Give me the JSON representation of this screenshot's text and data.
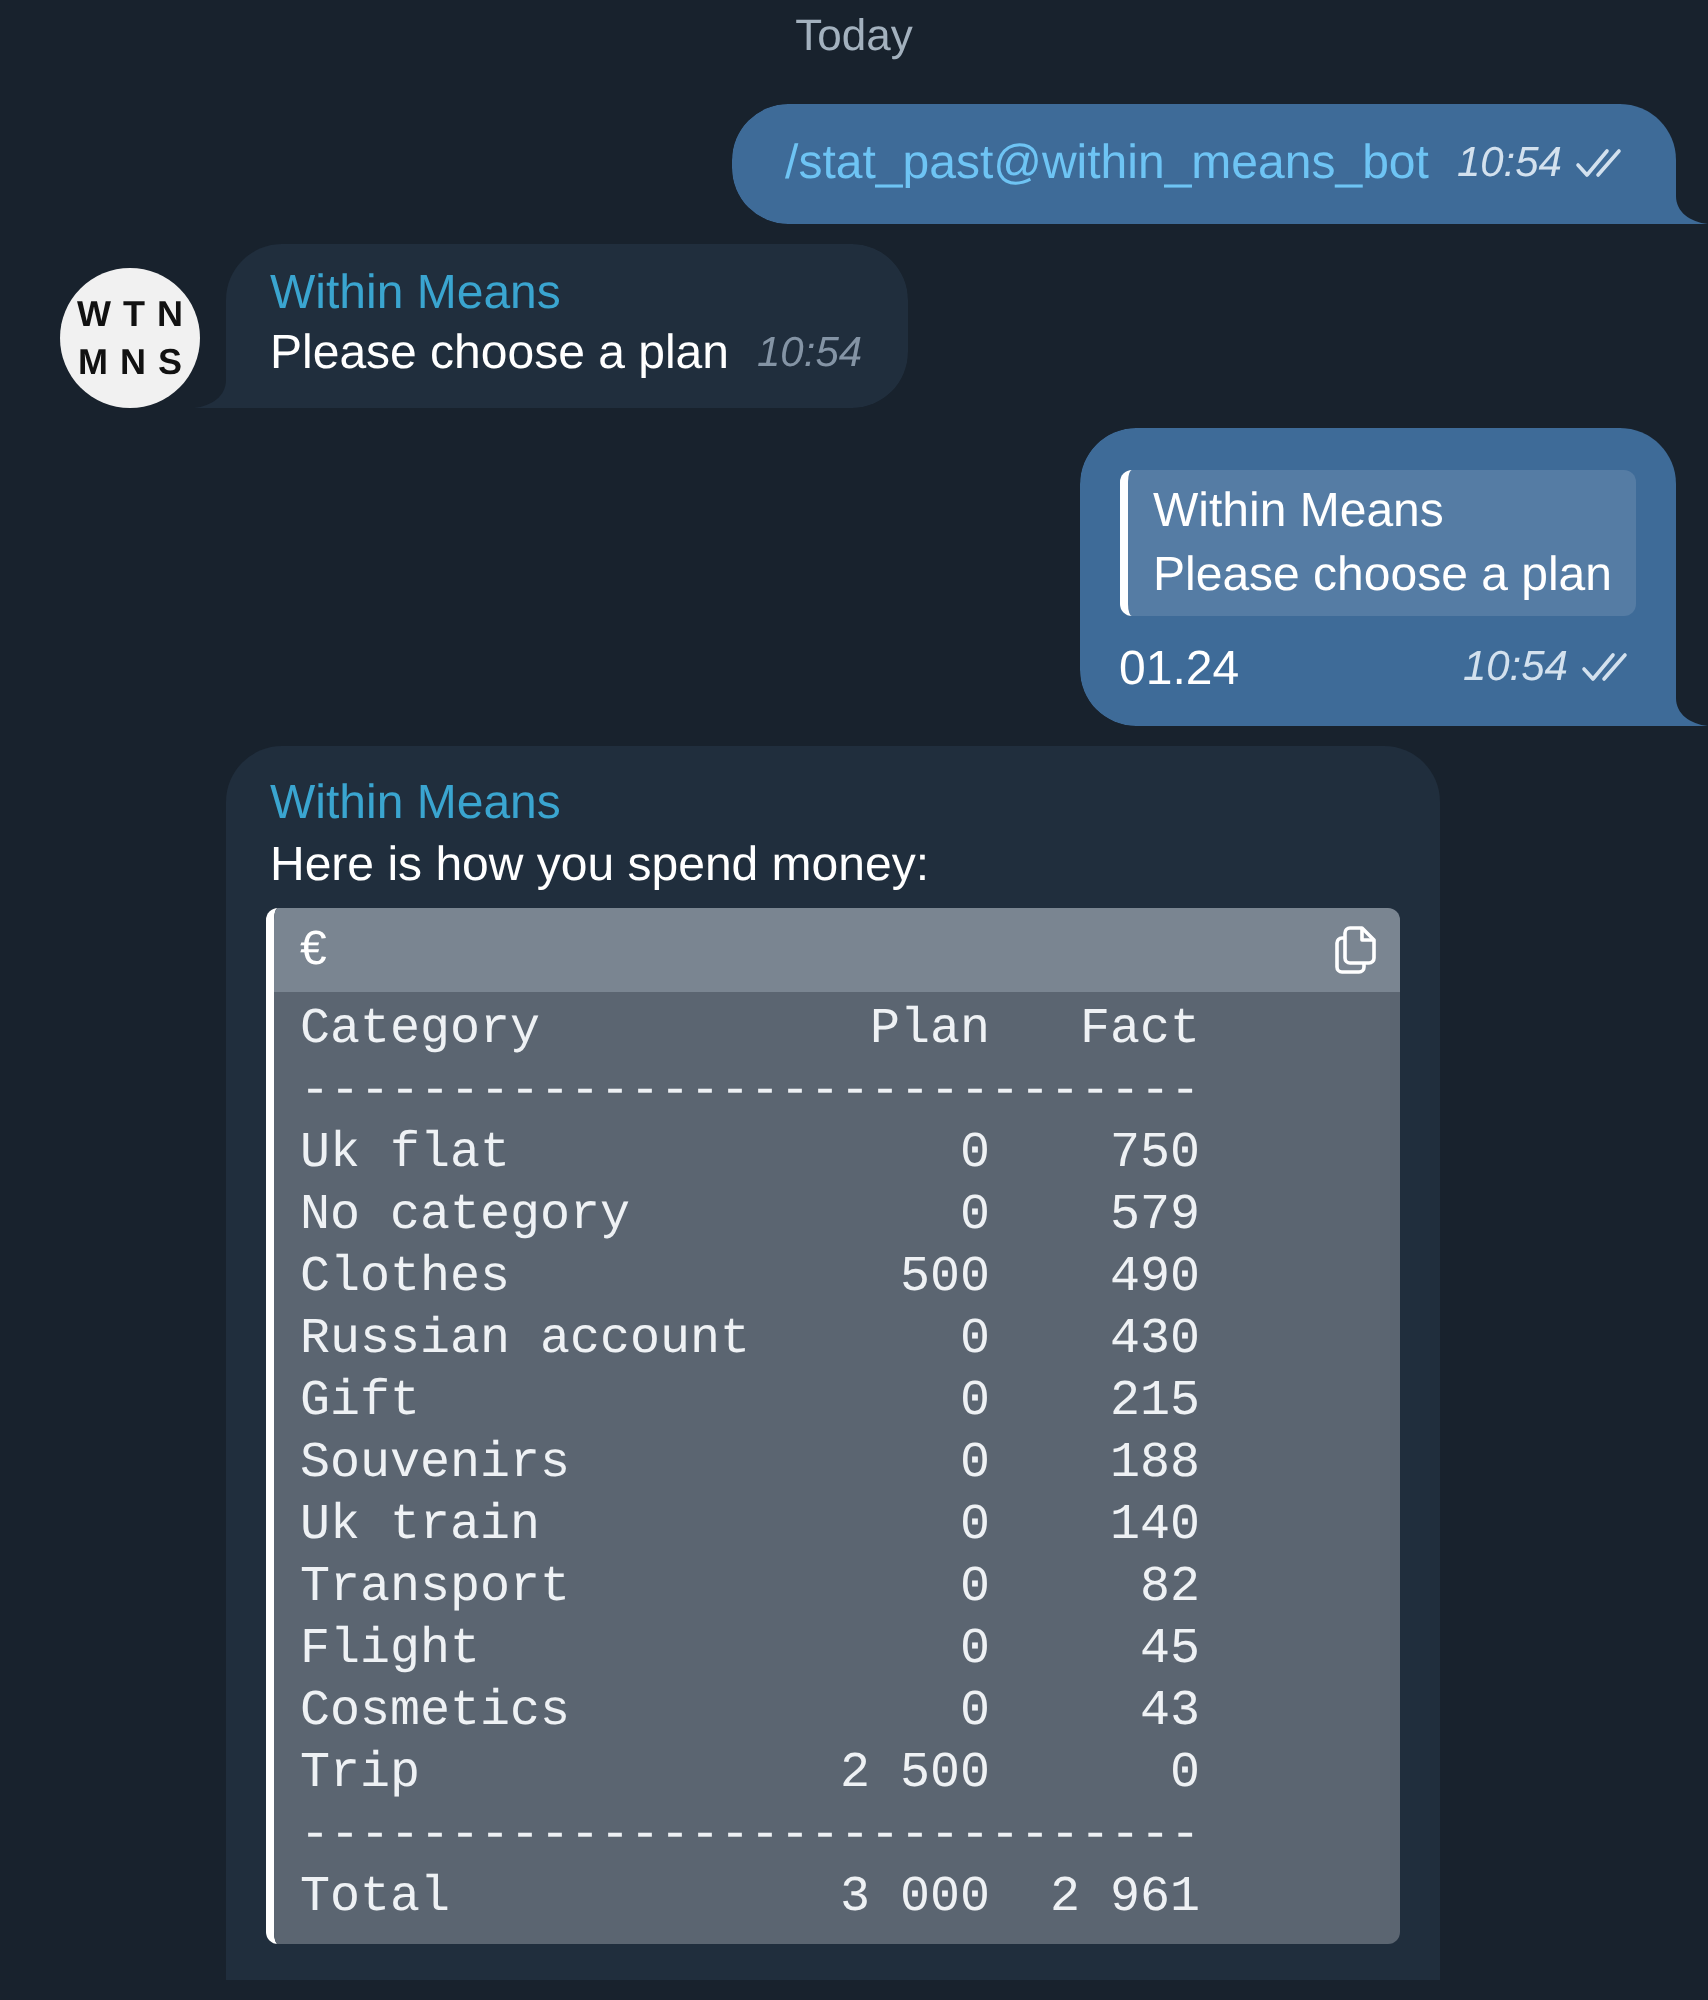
{
  "date_divider": "Today",
  "messages": [
    {
      "outgoing": true,
      "tail": true,
      "command": "/stat_past@within_means_bot",
      "time": "10:54",
      "read": true
    },
    {
      "outgoing": false,
      "tail": true,
      "avatar": {
        "lines": [
          "WTN",
          "MNS"
        ]
      },
      "sender": "Within Means",
      "text": "Please choose a plan",
      "time": "10:54"
    },
    {
      "outgoing": true,
      "tail": true,
      "reply_to": {
        "sender": "Within Means",
        "text": "Please choose a plan"
      },
      "text": "01.24",
      "time": "10:54",
      "read": true
    },
    {
      "outgoing": false,
      "tail": false,
      "sender": "Within Means",
      "text": "Here is how you spend money:",
      "code_block": {
        "language": "€",
        "lines": [
          {
            "kind": "header",
            "cells": [
              "Category",
              "Plan",
              "Fact"
            ]
          },
          {
            "kind": "rule",
            "text": "------------------------------"
          },
          {
            "kind": "row",
            "cells": [
              "Uk flat",
              "0",
              "750"
            ]
          },
          {
            "kind": "row",
            "cells": [
              "No category",
              "0",
              "579"
            ]
          },
          {
            "kind": "row",
            "cells": [
              "Clothes",
              "500",
              "490"
            ]
          },
          {
            "kind": "row",
            "cells": [
              "Russian account",
              "0",
              "430"
            ]
          },
          {
            "kind": "row",
            "cells": [
              "Gift",
              "0",
              "215"
            ]
          },
          {
            "kind": "row",
            "cells": [
              "Souvenirs",
              "0",
              "188"
            ]
          },
          {
            "kind": "row",
            "cells": [
              "Uk train",
              "0",
              "140"
            ]
          },
          {
            "kind": "row",
            "cells": [
              "Transport",
              "0",
              "82"
            ]
          },
          {
            "kind": "row",
            "cells": [
              "Flight",
              "0",
              "45"
            ]
          },
          {
            "kind": "row",
            "cells": [
              "Cosmetics",
              "0",
              "43"
            ]
          },
          {
            "kind": "row",
            "cells": [
              "Trip",
              "2 500",
              "0"
            ]
          },
          {
            "kind": "rule",
            "text": "------------------------------"
          },
          {
            "kind": "total",
            "cells": [
              "Total",
              "3 000",
              "2 961"
            ]
          }
        ]
      }
    }
  ]
}
